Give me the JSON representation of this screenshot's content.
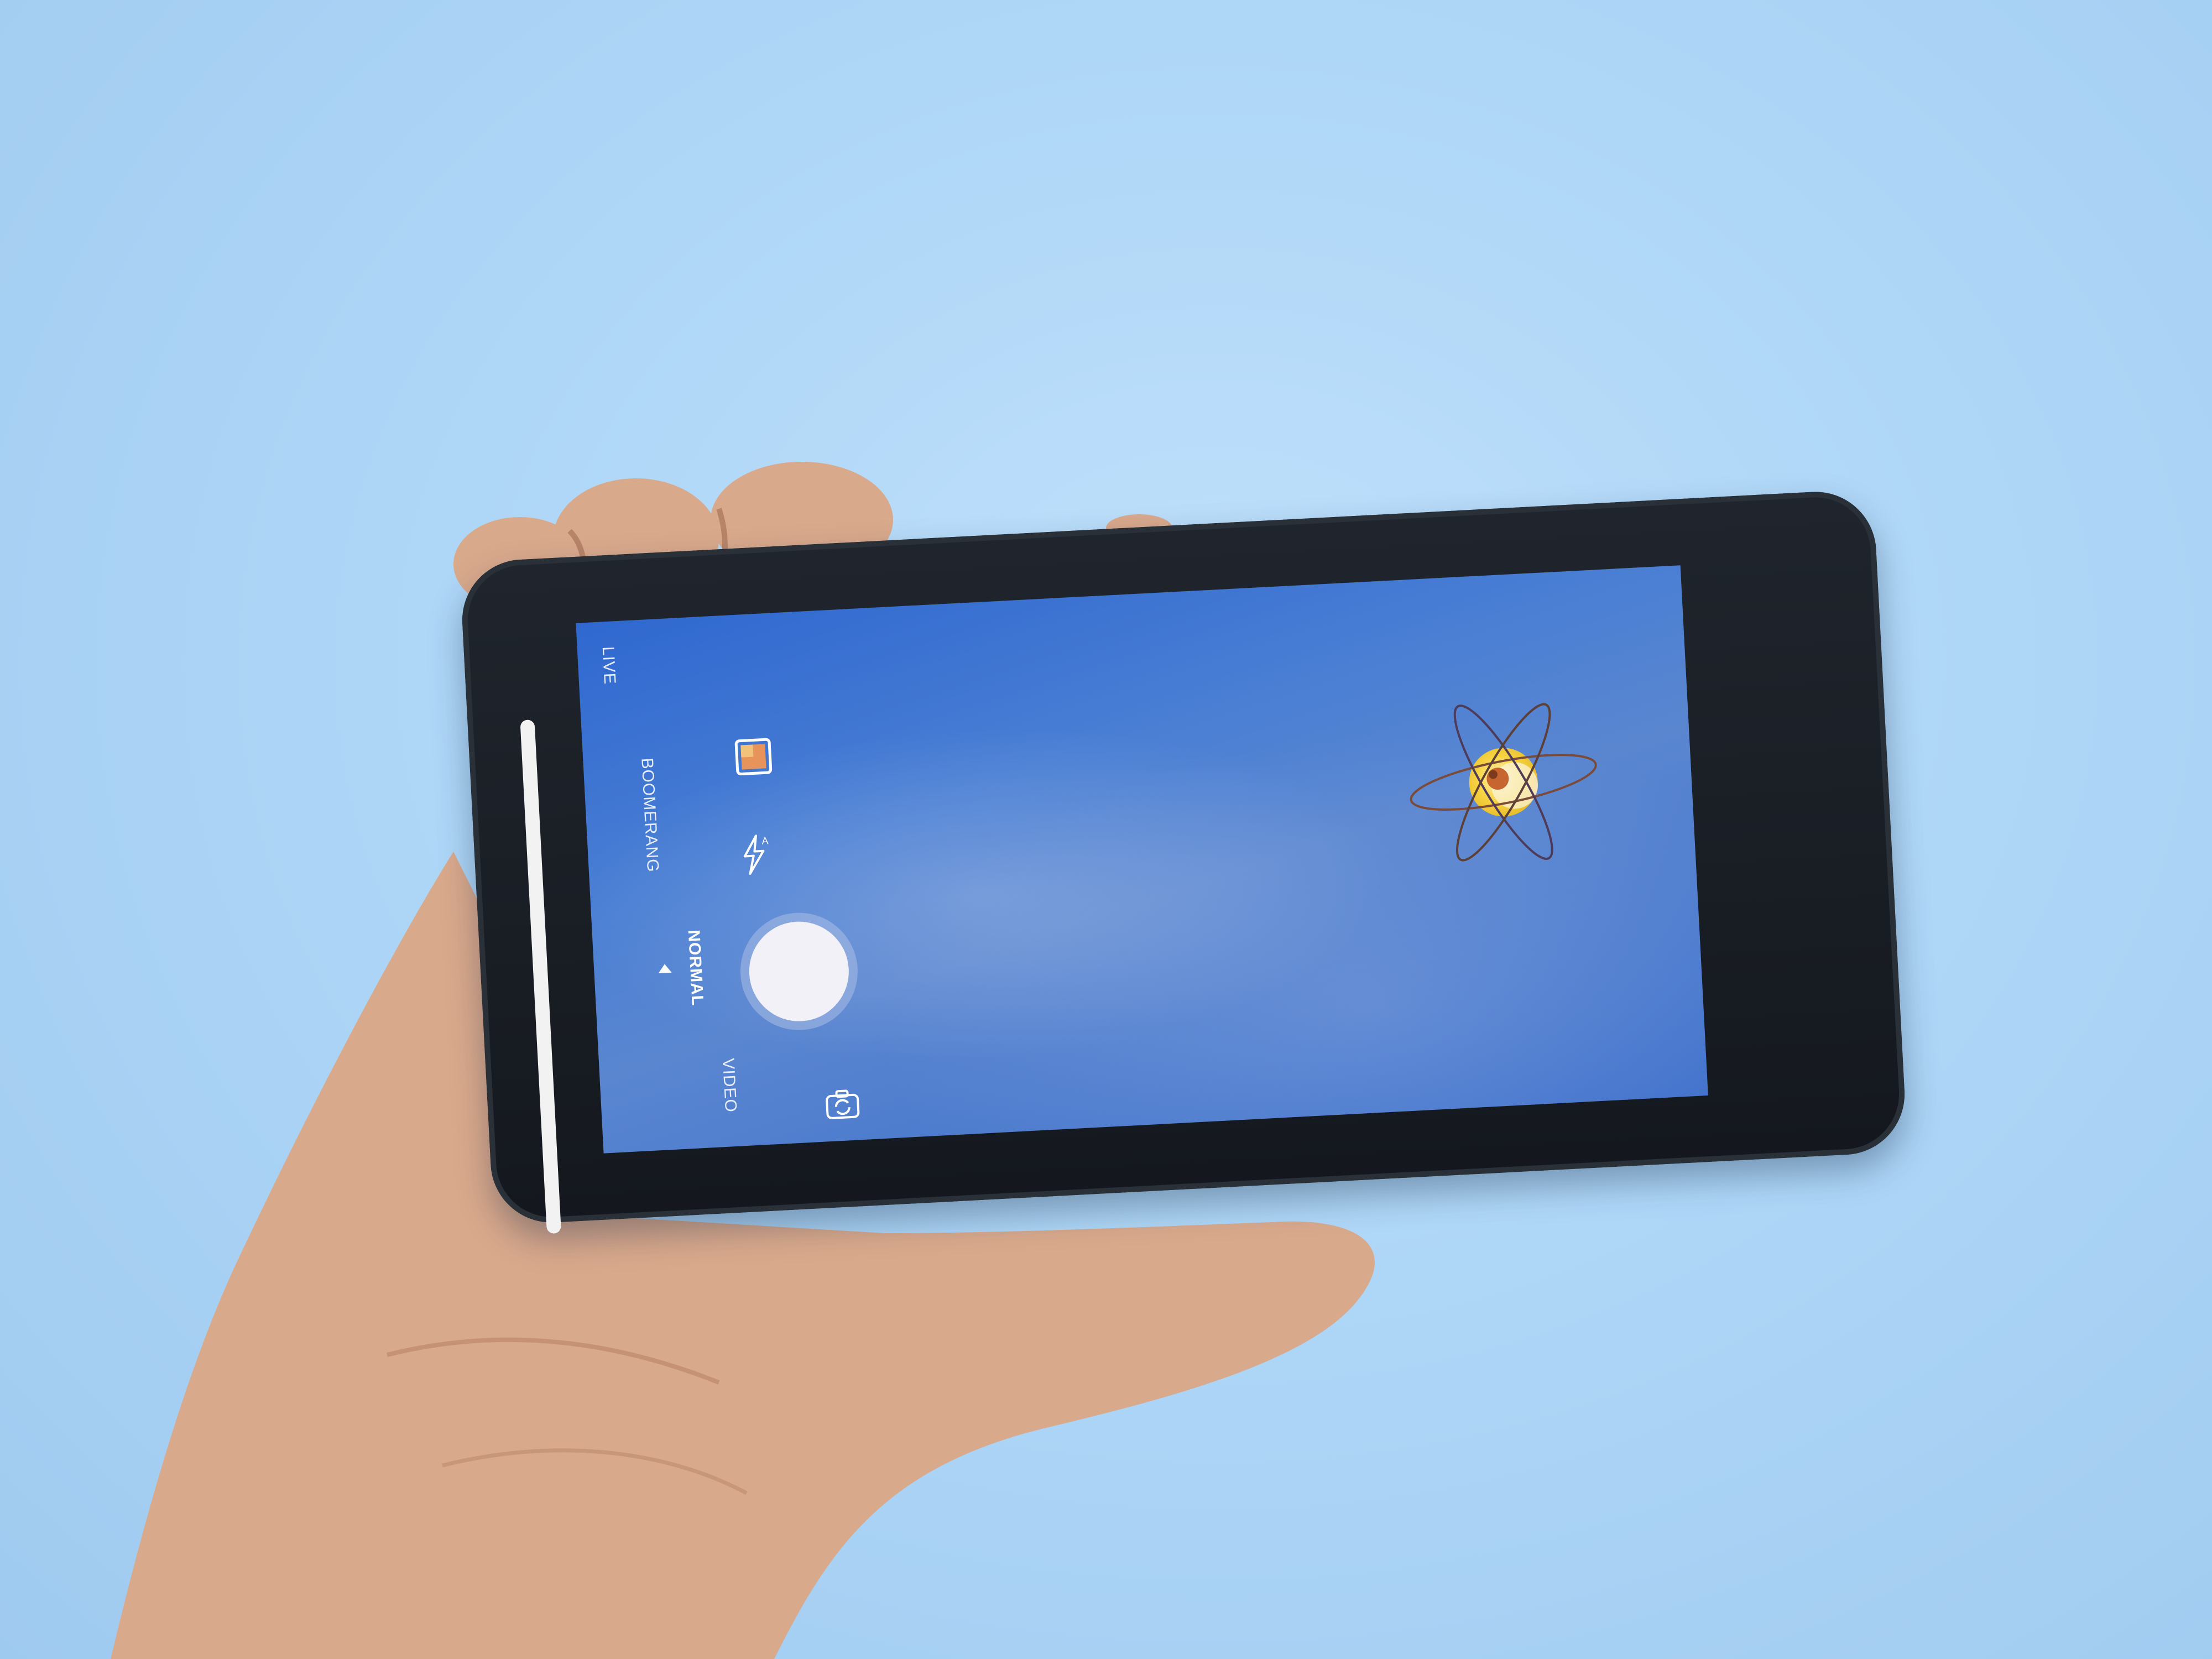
{
  "camera": {
    "modes": [
      {
        "label": "LIVE",
        "selected": false
      },
      {
        "label": "BOOMERANG",
        "selected": false
      },
      {
        "label": "NORMAL",
        "selected": true
      },
      {
        "label": "VIDEO",
        "selected": false
      }
    ],
    "icons": {
      "gallery": "gallery-icon",
      "flash": "flash-auto-icon",
      "shutter": "shutter-icon",
      "flip": "flip-camera-icon",
      "face": "face-filter-icon",
      "settings": "gear-icon",
      "sticker": "atom-sticker-icon"
    },
    "colors": {
      "sky": "#aed6f7",
      "screen": "#4a7fd4",
      "phone": "#1a1e24",
      "shutter": "#f1f1f7",
      "sticker": "#f5cf3a"
    }
  }
}
